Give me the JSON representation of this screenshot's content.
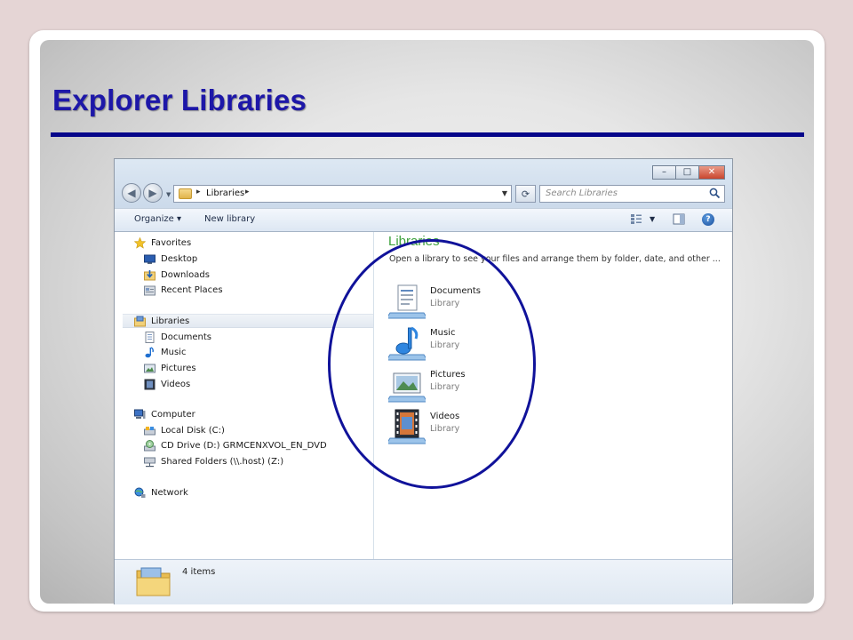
{
  "slide": {
    "title": "Explorer Libraries",
    "accent_color": "#1d17a8",
    "rule_color": "#06068a"
  },
  "window": {
    "controls": [
      "minimize-icon",
      "maximize-icon",
      "close-icon"
    ],
    "address": {
      "path": "Libraries",
      "separator": "▸"
    },
    "search": {
      "placeholder": "Search Libraries"
    },
    "command_bar": {
      "organize": "Organize ▾",
      "new_library": "New library"
    }
  },
  "nav": {
    "favorites": {
      "label": "Favorites",
      "items": [
        "Desktop",
        "Downloads",
        "Recent Places"
      ]
    },
    "libraries": {
      "label": "Libraries",
      "items": [
        "Documents",
        "Music",
        "Pictures",
        "Videos"
      ]
    },
    "computer": {
      "label": "Computer",
      "items": [
        "Local Disk (C:)",
        "CD Drive (D:) GRMCENXVOL_EN_DVD",
        "Shared Folders (\\\\.host) (Z:)"
      ]
    },
    "network": {
      "label": "Network"
    }
  },
  "content": {
    "heading": "Libraries",
    "description": "Open a library to see your files and arrange them by folder, date, and other ...",
    "libraries": [
      {
        "name": "Documents",
        "type": "Library",
        "icon": "documents-library-icon"
      },
      {
        "name": "Music",
        "type": "Library",
        "icon": "music-library-icon"
      },
      {
        "name": "Pictures",
        "type": "Library",
        "icon": "pictures-library-icon"
      },
      {
        "name": "Videos",
        "type": "Library",
        "icon": "videos-library-icon"
      }
    ]
  },
  "details": {
    "count": "4 items"
  },
  "annotation": {
    "color": "#10129a"
  }
}
